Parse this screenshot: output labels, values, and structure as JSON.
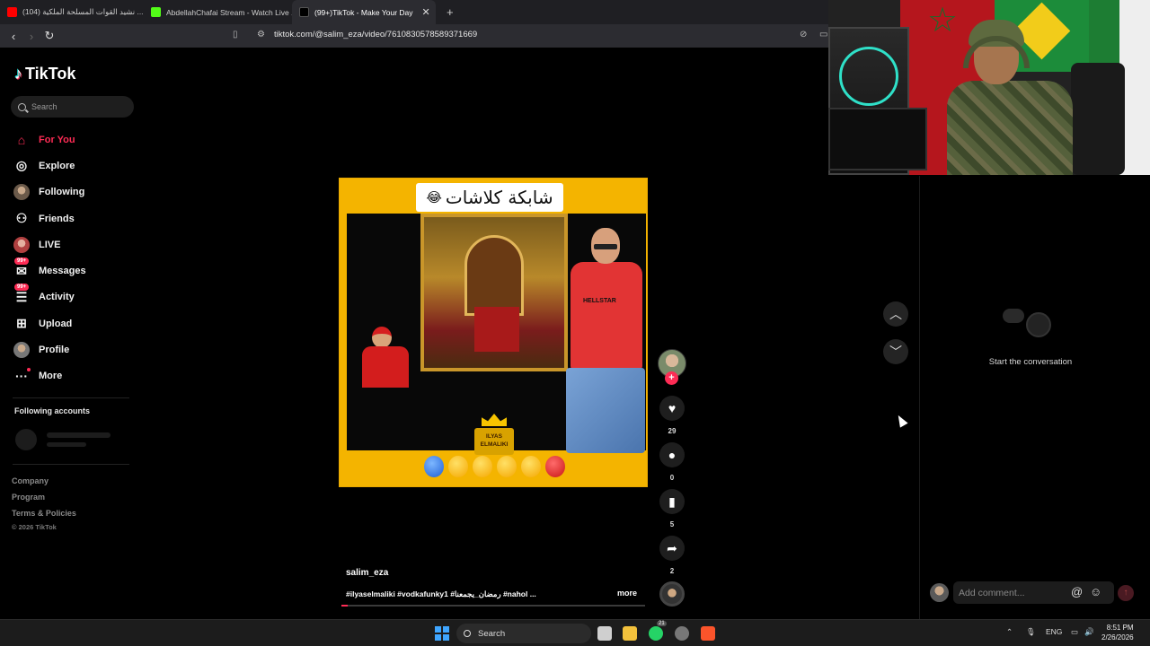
{
  "browser": {
    "tabs": [
      {
        "title": "(104) نشيد القوات المسلحة الملكية ...",
        "favicon_color": "#ff0000",
        "active": false
      },
      {
        "title": "AbdellahChafai Stream - Watch Live ...",
        "favicon_color": "#53fc18",
        "active": false
      },
      {
        "title": "(99+)TikTok - Make Your Day",
        "favicon_color": "#000000",
        "active": true
      }
    ],
    "close_glyph": "✕",
    "new_tab_glyph": "+",
    "back_icon": "‹",
    "forward_icon": "›",
    "reload_icon": "↻",
    "url": "tiktok.com/@salim_eza/video/7610830578589371669"
  },
  "sidebar": {
    "logo_text": "TikTok",
    "search_placeholder": "Search",
    "items": [
      {
        "label": "For You",
        "icon": "home-icon",
        "glyph": "⌂",
        "active": true
      },
      {
        "label": "Explore",
        "icon": "compass-icon",
        "glyph": "◎"
      },
      {
        "label": "Following",
        "icon": "following-avatar-icon",
        "glyph": ""
      },
      {
        "label": "Friends",
        "icon": "friends-icon",
        "glyph": "⚇"
      },
      {
        "label": "LIVE",
        "icon": "live-avatar-icon",
        "glyph": ""
      },
      {
        "label": "Messages",
        "icon": "messages-icon",
        "glyph": "✉",
        "badge": "99+"
      },
      {
        "label": "Activity",
        "icon": "activity-icon",
        "glyph": "☰",
        "badge": "99+"
      },
      {
        "label": "Upload",
        "icon": "upload-icon",
        "glyph": "⊞"
      },
      {
        "label": "Profile",
        "icon": "profile-avatar-icon",
        "glyph": ""
      },
      {
        "label": "More",
        "icon": "more-icon",
        "glyph": "···",
        "dot": true
      }
    ],
    "following_accounts_title": "Following accounts",
    "footer": [
      "Company",
      "Program",
      "Terms & Policies"
    ],
    "copyright": "© 2026 TikTok"
  },
  "video": {
    "overlay_title": "شابكة كلاشات",
    "overlay_emoji": "😂",
    "watermark": "ILYAS ELMALIKI",
    "author": "salim_eza",
    "caption": "#ilyaselmaliki #vodkafunky1 #رمضان_يجمعنا #nahol ...",
    "more_label": "more",
    "progress": 0.02
  },
  "actions": {
    "likes": "29",
    "comments": "0",
    "saves": "5",
    "shares": "2"
  },
  "comments_panel": {
    "empty_text": "Start the conversation",
    "input_placeholder": "Add comment...",
    "mention_icon": "@",
    "emoji_icon": "☺",
    "post_icon": "↑"
  },
  "taskbar": {
    "search_label": "Search",
    "whatsapp_badge": "21",
    "language": "ENG",
    "time": "8:51 PM",
    "date": "2/26/2026"
  },
  "colors": {
    "accent": "#fe2c55",
    "background": "#000000"
  }
}
